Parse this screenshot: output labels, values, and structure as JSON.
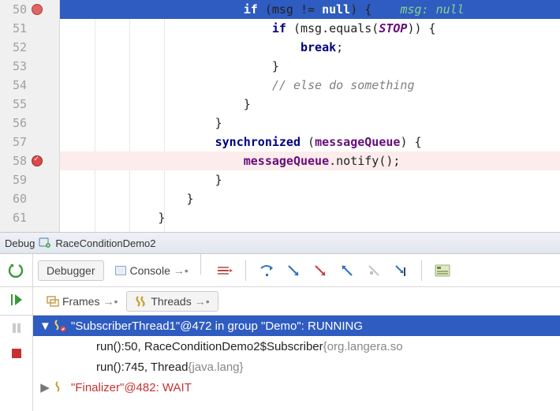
{
  "editor": {
    "lines": [
      {
        "n": 50,
        "bp": "red",
        "hl": "exec",
        "indent": 24,
        "segs": [
          [
            "kw",
            "if"
          ],
          [
            "sym",
            " (msg != "
          ],
          [
            "kw",
            "null"
          ],
          [
            "sym",
            ") {    "
          ],
          [
            "hint",
            "msg: null"
          ]
        ]
      },
      {
        "n": 51,
        "bp": null,
        "hl": null,
        "indent": 28,
        "segs": [
          [
            "kw",
            "if"
          ],
          [
            "sym",
            " (msg.equals("
          ],
          [
            "const",
            "STOP"
          ],
          [
            "sym",
            ")) {"
          ]
        ]
      },
      {
        "n": 52,
        "bp": null,
        "hl": null,
        "indent": 32,
        "segs": [
          [
            "kw",
            "break"
          ],
          [
            "sym",
            ";"
          ]
        ]
      },
      {
        "n": 53,
        "bp": null,
        "hl": null,
        "indent": 28,
        "segs": [
          [
            "sym",
            "}"
          ]
        ]
      },
      {
        "n": 54,
        "bp": null,
        "hl": null,
        "indent": 28,
        "segs": [
          [
            "comment",
            "// else do something"
          ]
        ]
      },
      {
        "n": 55,
        "bp": null,
        "hl": null,
        "indent": 24,
        "segs": [
          [
            "sym",
            "}"
          ]
        ]
      },
      {
        "n": 56,
        "bp": null,
        "hl": null,
        "indent": 20,
        "segs": [
          [
            "sym",
            "}"
          ]
        ]
      },
      {
        "n": 57,
        "bp": null,
        "hl": null,
        "indent": 20,
        "segs": [
          [
            "kw",
            "synchronized"
          ],
          [
            "sym",
            " ("
          ],
          [
            "ident",
            "messageQueue"
          ],
          [
            "sym",
            ") {"
          ]
        ]
      },
      {
        "n": 58,
        "bp": "redcheck",
        "hl": "err",
        "indent": 24,
        "segs": [
          [
            "ident",
            "messageQueue"
          ],
          [
            "sym",
            ".notify();"
          ]
        ]
      },
      {
        "n": 59,
        "bp": null,
        "hl": null,
        "indent": 20,
        "segs": [
          [
            "sym",
            "}"
          ]
        ]
      },
      {
        "n": 60,
        "bp": null,
        "hl": null,
        "indent": 16,
        "segs": [
          [
            "sym",
            "}"
          ]
        ]
      },
      {
        "n": 61,
        "bp": null,
        "hl": null,
        "indent": 12,
        "segs": [
          [
            "sym",
            "}"
          ]
        ],
        "fold": "up"
      }
    ]
  },
  "debug": {
    "title_prefix": "Debug",
    "config_name": "RaceConditionDemo2",
    "tabs": {
      "debugger": "Debugger",
      "console": "Console"
    },
    "frames_tabs": {
      "frames": "Frames",
      "threads": "Threads"
    },
    "thread": {
      "name": "\"SubscriberThread1\"@472 in group \"Demo\": RUNNING",
      "stack": [
        {
          "method": "run():50, RaceConditionDemo2$Subscriber ",
          "pkg": "{org.langera.so"
        },
        {
          "method": "run():745, Thread ",
          "pkg": "{java.lang}"
        }
      ],
      "next": "\"Finalizer\"@482: WAIT"
    }
  }
}
